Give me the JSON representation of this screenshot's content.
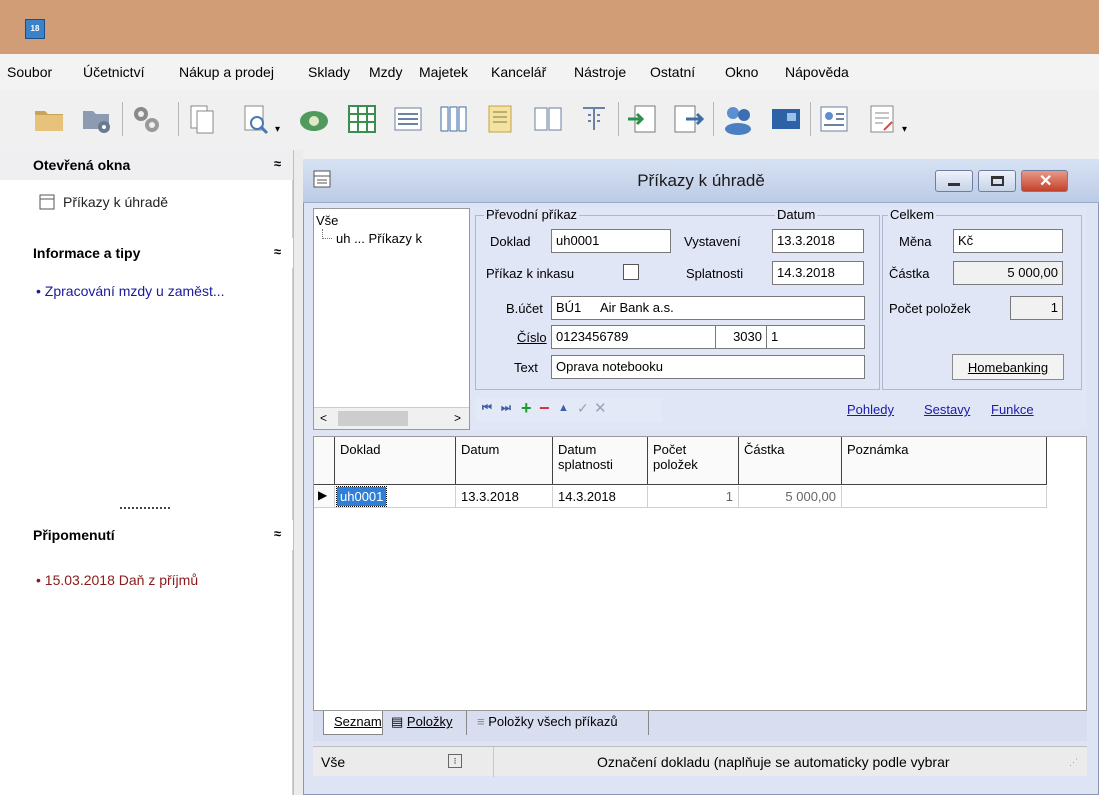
{
  "app": {
    "icon_label": "18"
  },
  "menu": [
    "Soubor",
    "Účetnictví",
    "Nákup a prodej",
    "Sklady",
    "Mzdy",
    "Majetek",
    "Kancelář",
    "Nástroje",
    "Ostatní",
    "Okno",
    "Nápověda"
  ],
  "toolbar": {
    "icons": [
      "folder-icon",
      "folder-settings-icon",
      "gears-icon",
      "copy-icon",
      "print-preview-icon",
      "money-icon",
      "grid-table-icon",
      "form-icon",
      "columns-icon",
      "document-icon",
      "book-icon",
      "text-icon",
      "import-icon",
      "export-icon",
      "users-icon",
      "card-icon",
      "contact-icon",
      "report-icon"
    ]
  },
  "sidebar": {
    "open_windows": {
      "title": "Otevřená okna",
      "items": [
        "Příkazy k úhradě"
      ]
    },
    "tips": {
      "title": "Informace a tipy",
      "items": [
        "Zpracování mzdy u zaměst..."
      ]
    },
    "reminders": {
      "title": "Připomenutí",
      "items": [
        "15.03.2018 Daň z příjmů"
      ]
    },
    "colors": {
      "tip_link": "#1a1a9a",
      "reminder": "#8b1a1a"
    }
  },
  "window": {
    "title": "Příkazy k úhradě",
    "tree": {
      "root": "Vše",
      "child": "uh ... Příkazy k"
    },
    "transfer": {
      "group_label": "Převodní příkaz",
      "doc_label": "Doklad",
      "doc_value": "uh0001",
      "collection_label": "Příkaz k inkasu",
      "account_label": "B.účet",
      "account_code": "BÚ1",
      "account_bank": "Air Bank a.s.",
      "number_label": "Číslo",
      "number_value": "0123456789",
      "bank_code": "3030",
      "number_extra": "1",
      "text_label": "Text",
      "text_value": "Oprava notebooku"
    },
    "date": {
      "group_label": "Datum",
      "issue_label": "Vystavení",
      "issue_value": "13.3.2018",
      "due_label": "Splatnosti",
      "due_value": "14.3.2018"
    },
    "total": {
      "group_label": "Celkem",
      "currency_label": "Měna",
      "currency_value": "Kč",
      "amount_label": "Částka",
      "amount_value": "5 000,00",
      "count_label": "Počet položek",
      "count_value": "1",
      "homebanking_label": "Homebanking"
    },
    "links": [
      "Pohledy",
      "Sestavy",
      "Funkce"
    ],
    "grid": {
      "headers": [
        "Doklad",
        "Datum",
        "Datum splatnosti",
        "Počet položek",
        "Částka",
        "Poznámka"
      ],
      "rows": [
        [
          "uh0001",
          "13.3.2018",
          "14.3.2018",
          "1",
          "5 000,00",
          ""
        ]
      ]
    },
    "tabs": [
      "Seznam",
      "Položky",
      "Položky všech příkazů"
    ],
    "status": {
      "left": "Vše",
      "right": "Označení dokladu (naplňuje se automaticky podle vybrar"
    }
  }
}
